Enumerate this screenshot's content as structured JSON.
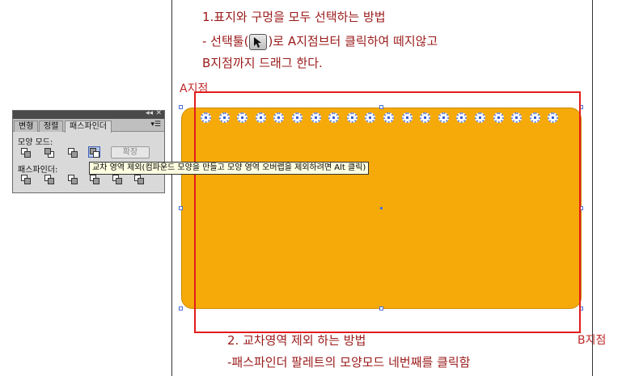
{
  "instructions": {
    "line1": "1.표지와 구멍을 모두 선택하는 방법",
    "line2_before": "- 선택툴(",
    "line2_after": ")로 A지점브터 클릭하여 떼지않고",
    "line3": "B지점까지 드래그 한다.",
    "line4": "2. 교차영역 제외 하는 방법",
    "line5": "-패스파인더 팔레트의 모양모드 네번째를 클릭함"
  },
  "labels": {
    "point_a": "A지점",
    "point_b": "B지점"
  },
  "panel": {
    "tabs": [
      "변형",
      "정렬",
      "패스파인더"
    ],
    "active_tab": 2,
    "menu_icon": "panel-menu-icon",
    "shape_modes_label": "모양 모드:",
    "pathfinder_label": "패스파인더:",
    "expand_label": "확장",
    "collapse_glyph": "◂◂",
    "close_glyph": "✕"
  },
  "tooltip": {
    "text": "교차 영역 제외(컴파운드 모양을 만들고 모양 영역 오버랩을 제외하려면 Alt 클릭)"
  },
  "colors": {
    "shape_fill": "#f5aa0a",
    "instruction_text": "#9a1a1a",
    "selection_rect": "#e31b1b",
    "selection_handles": "#4a6fd8"
  },
  "hole_count": 20
}
